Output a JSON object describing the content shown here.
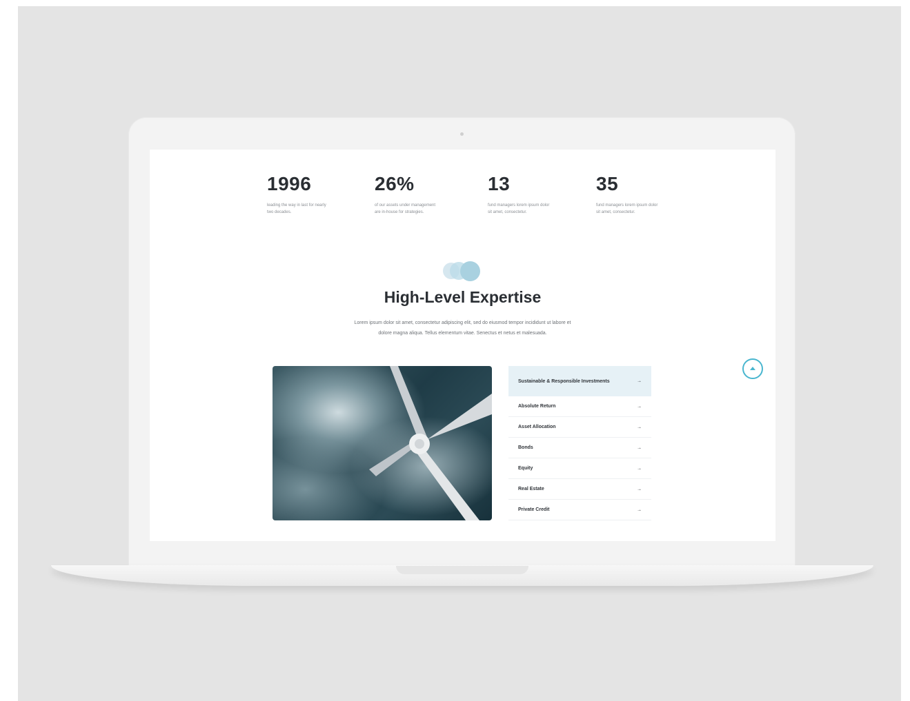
{
  "stats": [
    {
      "value": "1996",
      "description": "leading the way in last for nearly two decades."
    },
    {
      "value": "26%",
      "description": "of our assets under management are in-house for strategies."
    },
    {
      "value": "13",
      "description": "fund managers lorem ipsum dolor sit amet, consectetur."
    },
    {
      "value": "35",
      "description": "fund managers lorem ipsum dolor sit amet, consectetur."
    }
  ],
  "section": {
    "title": "High-Level Expertise",
    "intro": "Lorem ipsum dolor sit amet, consectetur adipiscing elit, sed do eiusmod tempor incididunt ut labore et dolore magna aliqua. Tellus elementum vitae. Senectus et netus et malesuada."
  },
  "menu": {
    "items": [
      {
        "label": "Sustainable & Responsible Investments",
        "active": true
      },
      {
        "label": "Absolute Return"
      },
      {
        "label": "Asset Allocation"
      },
      {
        "label": "Bonds"
      },
      {
        "label": "Equity"
      },
      {
        "label": "Real Estate"
      },
      {
        "label": "Private Credit"
      }
    ],
    "arrow_glyph": "→"
  },
  "colors": {
    "accent": "#49b6cf",
    "active_bg": "#e6f1f6",
    "dot_light": "#d6e7ef",
    "dot_mid": "#bcdce8",
    "dot_dark": "#a9d1e0"
  },
  "icons": {
    "scroll_top": "chevron-up-icon",
    "decorative_dots": "circles-icon"
  }
}
